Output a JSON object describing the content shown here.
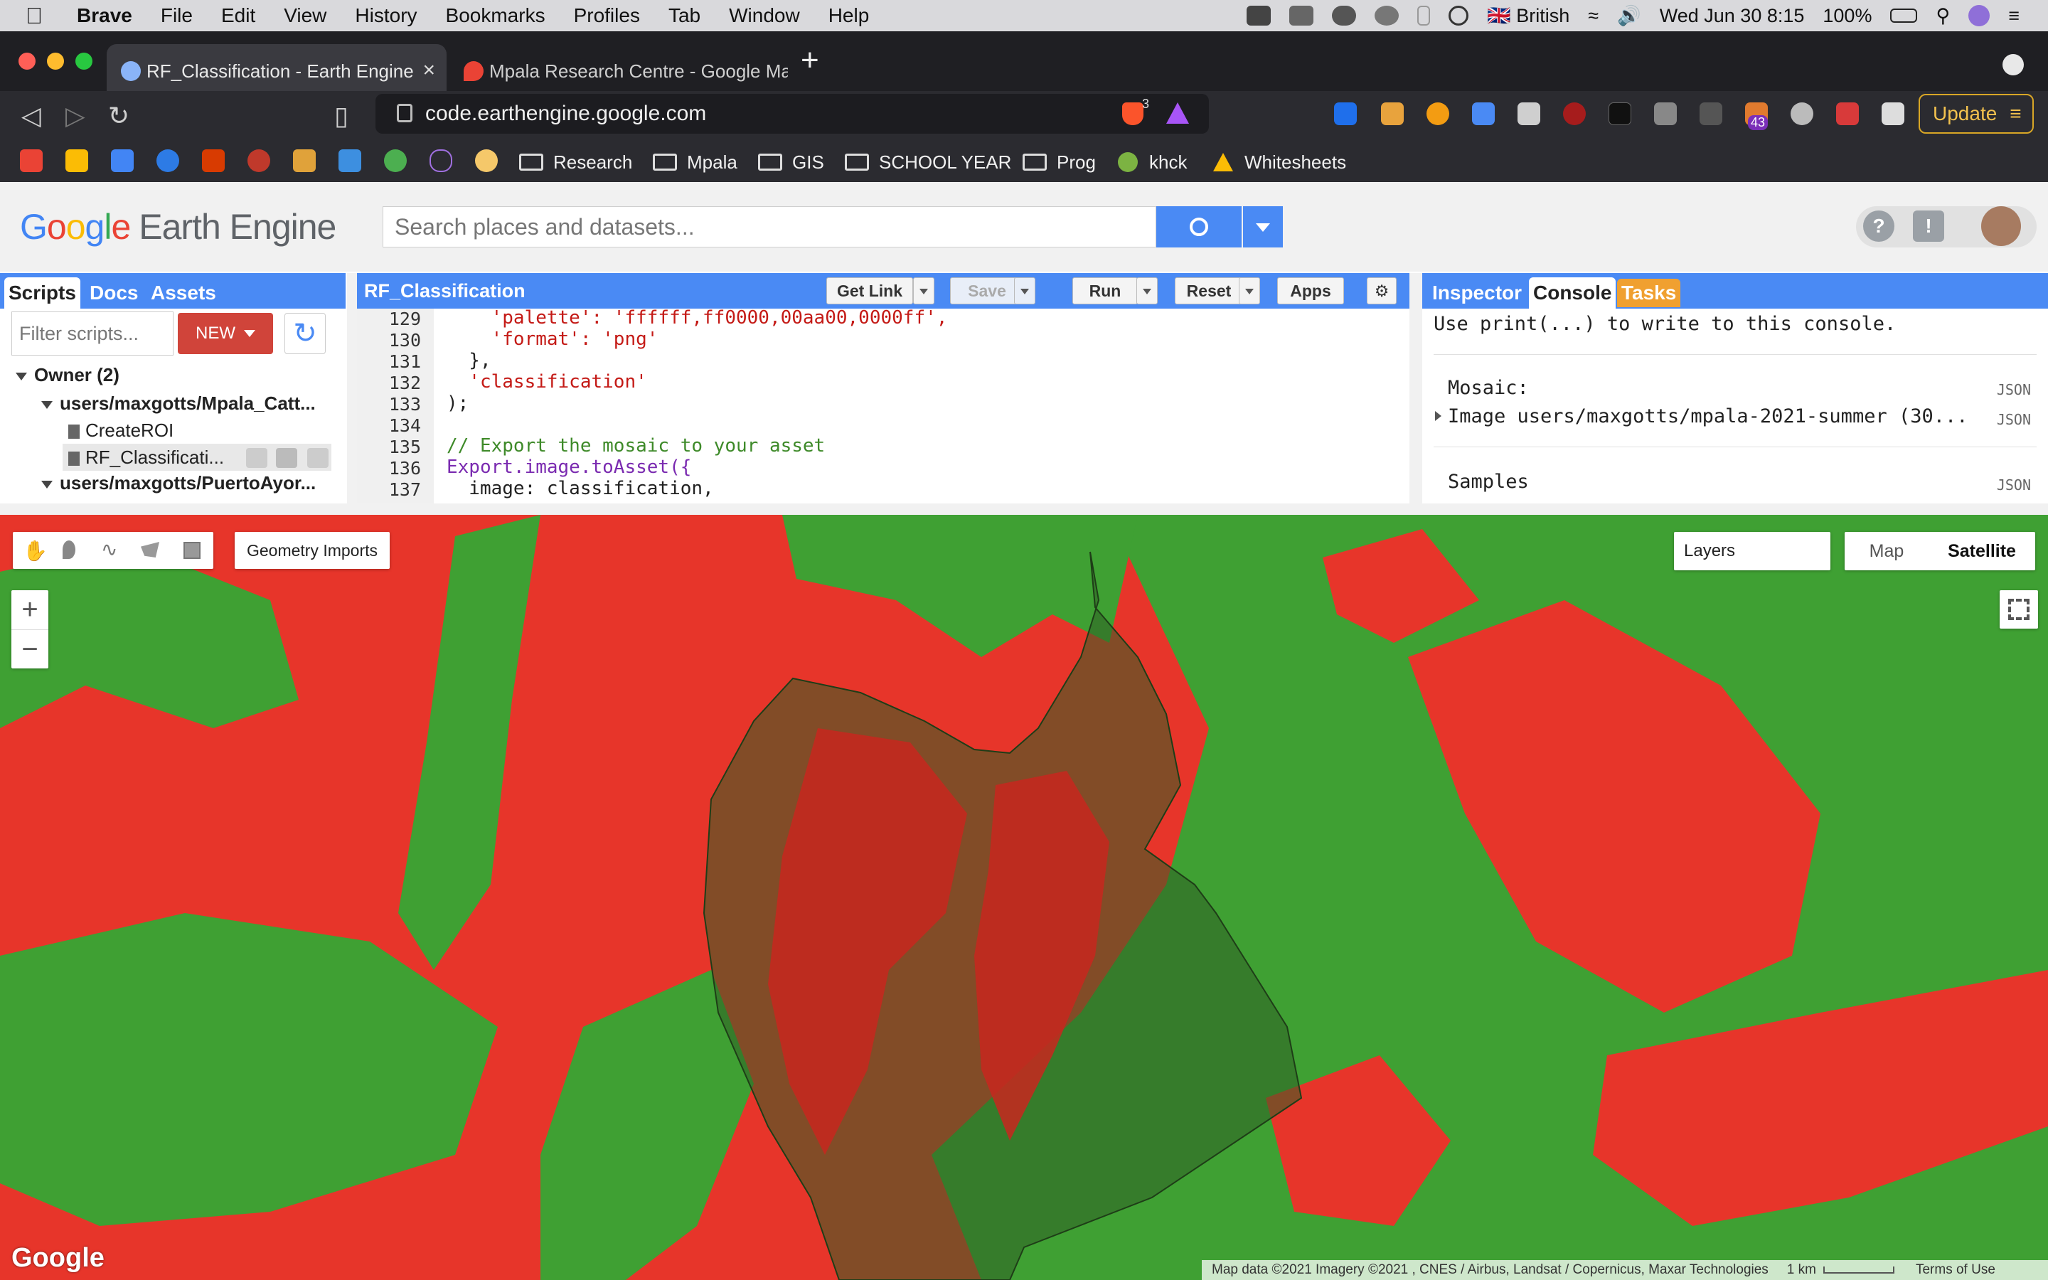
{
  "menubar": {
    "app": "Brave",
    "items": [
      "File",
      "Edit",
      "View",
      "History",
      "Bookmarks",
      "Profiles",
      "Tab",
      "Window",
      "Help"
    ],
    "language": "British",
    "datetime": "Wed Jun 30  8:15",
    "battery": "100%"
  },
  "tabs": [
    {
      "title": "RF_Classification - Earth Engine"
    },
    {
      "title": "Mpala Research Centre - Google Ma"
    }
  ],
  "address": {
    "url": "code.earthengine.google.com",
    "shield_count": "3",
    "ext_badge": "43",
    "update_label": "Update"
  },
  "bookmarks": [
    "Research",
    "Mpala",
    "GIS",
    "SCHOOL YEAR",
    "Prog",
    "khck",
    "Whitesheets"
  ],
  "gee": {
    "logo_google": [
      "G",
      "o",
      "o",
      "g",
      "l",
      "e"
    ],
    "logo_product": "Earth Engine",
    "search_placeholder": "Search places and datasets..."
  },
  "left_panel": {
    "tabs": [
      "Scripts",
      "Docs",
      "Assets"
    ],
    "filter_placeholder": "Filter scripts...",
    "new_label": "NEW",
    "tree": [
      {
        "label": "Owner (2)"
      },
      {
        "label": "users/maxgotts/Mpala_Catt..."
      },
      {
        "label": "CreateROI"
      },
      {
        "label": "RF_Classificati..."
      },
      {
        "label": "users/maxgotts/PuertoAyor..."
      }
    ]
  },
  "editor": {
    "title": "RF_Classification",
    "buttons": {
      "get_link": "Get Link",
      "save": "Save",
      "run": "Run",
      "reset": "Reset",
      "apps": "Apps"
    },
    "lines": [
      {
        "n": "129",
        "code": "    'palette': 'ffffff,ff0000,00aa00,0000ff',"
      },
      {
        "n": "130",
        "code": "    'format': 'png'"
      },
      {
        "n": "131",
        "code": "  },"
      },
      {
        "n": "132",
        "code": "  'classification'"
      },
      {
        "n": "133",
        "code": ");"
      },
      {
        "n": "134",
        "code": ""
      },
      {
        "n": "135",
        "code": "// Export the mosaic to your asset"
      },
      {
        "n": "136",
        "code": "Export.image.toAsset({"
      },
      {
        "n": "137",
        "code": "  image: classification,"
      }
    ]
  },
  "right_panel": {
    "tabs": [
      "Inspector",
      "Console",
      "Tasks"
    ],
    "hint": "Use print(...) to write to this console.",
    "entries": [
      {
        "label": "Mosaic:",
        "tag": "JSON"
      },
      {
        "label": "Image users/maxgotts/mpala-2021-summer (30...",
        "tag": "JSON"
      },
      {
        "label": "Samples",
        "tag": "JSON"
      }
    ]
  },
  "map": {
    "geometry_imports": "Geometry Imports",
    "layers": "Layers",
    "map_label": "Map",
    "satellite_label": "Satellite",
    "attribution": "Map data ©2021 Imagery ©2021 , CNES / Airbus, Landsat / Copernicus, Maxar Technologies",
    "scale": "1 km",
    "terms": "Terms of Use",
    "watermark": "Google",
    "colors": {
      "urban": "#e7352a",
      "vegetation": "#3fa033",
      "aoi_fill": "#2f5e24"
    }
  }
}
